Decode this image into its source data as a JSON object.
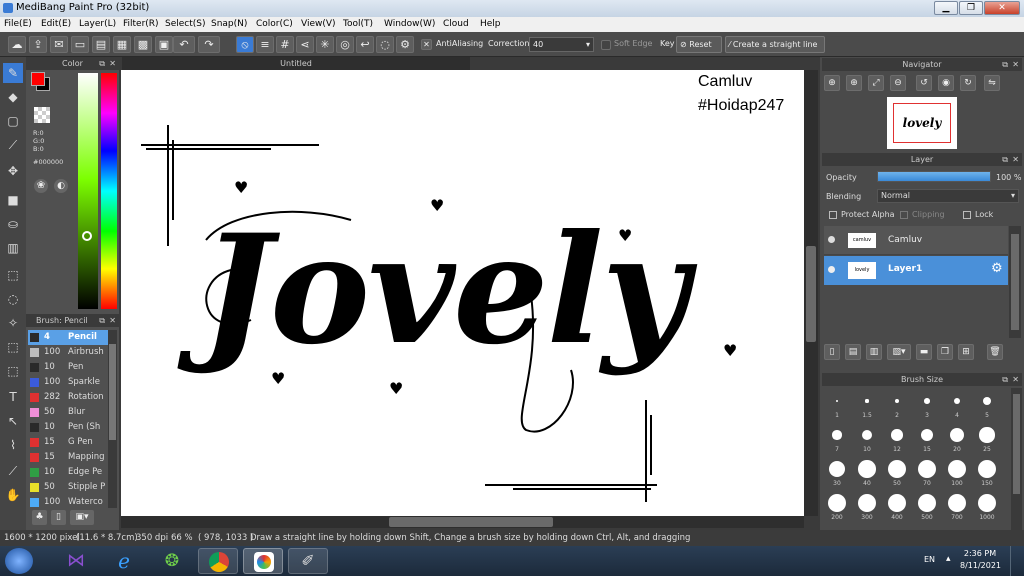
{
  "window": {
    "title": "MediBang Paint Pro (32bit)"
  },
  "menu": [
    "File(E)",
    "Edit(E)",
    "Layer(L)",
    "Filter(R)",
    "Select(S)",
    "Snap(N)",
    "Color(C)",
    "View(V)",
    "Tool(T)",
    "Window(W)",
    "Cloud",
    "Help"
  ],
  "toolbar": {
    "antialiasing_label": "AntiAliasing",
    "correction_label": "Correction",
    "correction_value": "40",
    "soft_edge_label": "Soft Edge",
    "key_label": "Key",
    "reset_label": "Reset",
    "straight_line_label": "Create a straight line"
  },
  "color_panel": {
    "title": "Color",
    "r": "R:0",
    "g": "G:0",
    "b": "B:0",
    "hex": "#000000",
    "foreground": "#ff0000"
  },
  "brush_panel": {
    "title": "Brush: Pencil",
    "items": [
      {
        "size": "4",
        "name": "Pencil",
        "color": "#2a2a2a",
        "selected": true
      },
      {
        "size": "100",
        "name": "Airbrush",
        "color": "#bdbdbd"
      },
      {
        "size": "10",
        "name": "Pen",
        "color": "#2a2a2a"
      },
      {
        "size": "100",
        "name": "Sparkle",
        "color": "#3b5bdb"
      },
      {
        "size": "282",
        "name": "Rotation",
        "color": "#e03131"
      },
      {
        "size": "50",
        "name": "Blur",
        "color": "#f08fd8"
      },
      {
        "size": "10",
        "name": "Pen (Sh",
        "color": "#2a2a2a"
      },
      {
        "size": "15",
        "name": "G Pen",
        "color": "#e03131"
      },
      {
        "size": "15",
        "name": "Mapping",
        "color": "#e03131"
      },
      {
        "size": "10",
        "name": "Edge Pe",
        "color": "#2f9e44"
      },
      {
        "size": "50",
        "name": "Stipple P",
        "color": "#e8e02a"
      },
      {
        "size": "100",
        "name": "Waterco",
        "color": "#4dabf7"
      }
    ]
  },
  "document": {
    "tab": "Untitled"
  },
  "canvas": {
    "lettering": "Jovely",
    "watermark_line1": "Camluv",
    "watermark_line2": "#Hoidap247"
  },
  "navigator": {
    "title": "Navigator",
    "thumb_text": "lovely"
  },
  "layer_panel": {
    "title": "Layer",
    "opacity_label": "Opacity",
    "opacity_value": "100 %",
    "opacity": 1.0,
    "blending_label": "Blending",
    "blending_value": "Normal",
    "protect_alpha_label": "Protect Alpha",
    "clipping_label": "Clipping",
    "lock_label": "Lock",
    "layers": [
      {
        "name": "Camluv",
        "thumb": "camluv",
        "selected": false
      },
      {
        "name": "Layer1",
        "thumb": "lovely",
        "selected": true
      }
    ]
  },
  "brush_size": {
    "title": "Brush Size",
    "sizes": [
      "1",
      "1.5",
      "2",
      "3",
      "4",
      "5",
      "7",
      "10",
      "12",
      "15",
      "20",
      "25",
      "30",
      "40",
      "50",
      "70",
      "100",
      "150",
      "200",
      "300",
      "400",
      "500",
      "700",
      "1000"
    ]
  },
  "status": {
    "size": "1600 * 1200 pixel",
    "dimensions": "(11.6 * 8.7cm)",
    "dpi": "350 dpi",
    "zoom": "66 %",
    "coords": "( 978, 1033 )",
    "hint": "Draw a straight line by holding down Shift, Change a brush size by holding down Ctrl, Alt, and dragging"
  },
  "taskbar": {
    "lang": "EN",
    "time": "2:36 PM",
    "date": "8/11/2021"
  },
  "icons": [
    "antialias-icon",
    "undo-icon",
    "redo-icon",
    "pencil-icon",
    "eraser-icon",
    "move-icon",
    "fill-icon",
    "text-icon",
    "hand-icon",
    "eyedropper-icon",
    "gear-icon",
    "visibility-icon"
  ]
}
